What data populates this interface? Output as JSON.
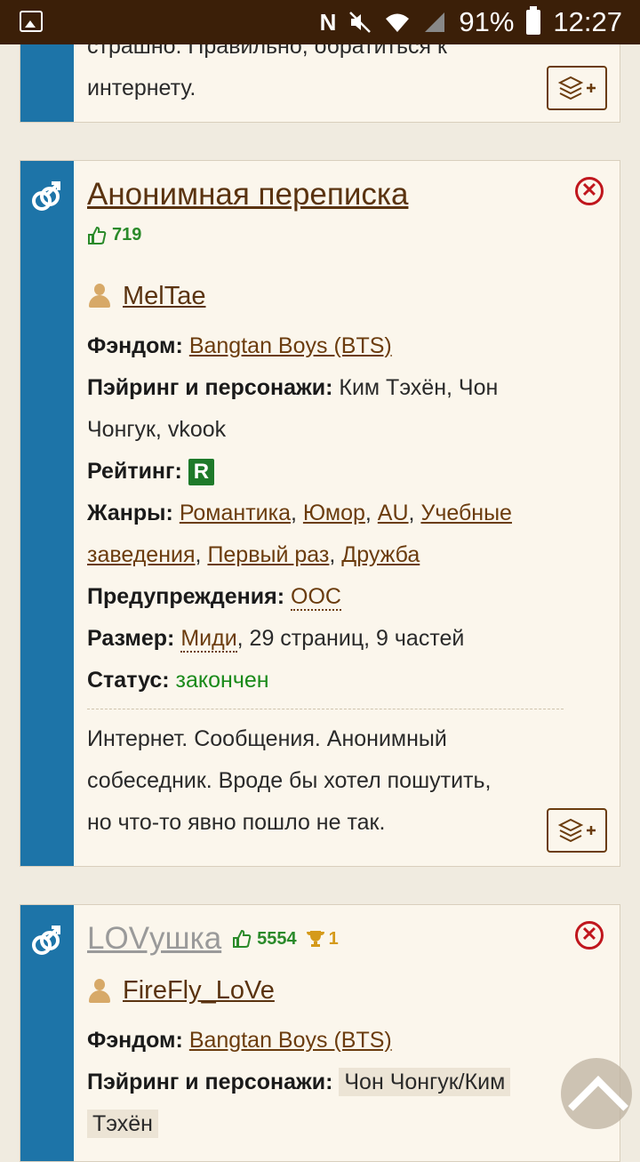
{
  "status_bar": {
    "battery": "91%",
    "time": "12:27",
    "icons": [
      "gallery-icon",
      "nfc-icon",
      "mute-icon",
      "wifi-icon",
      "signal-icon",
      "battery-icon"
    ]
  },
  "card0": {
    "desc_partial": "страшно. Правильно, обратиться к",
    "desc_end": "интернету."
  },
  "card1": {
    "title": "Анонимная переписка",
    "likes": "719",
    "author": "MelTae",
    "fandom_label": "Фэндом:",
    "fandom": "Bangtan Boys (BTS)",
    "pairing_label": "Пэйринг и персонажи:",
    "pairing_line1": "Ким Тэхён, Чон",
    "pairing_line2": "Чонгук, vkook",
    "rating_label": "Рейтинг:",
    "rating": "R",
    "genres_label": "Жанры:",
    "genres": [
      "Романтика",
      "Юмор",
      "AU",
      "Учебные",
      "заведения",
      "Первый раз",
      "Дружба"
    ],
    "warnings_label": "Предупреждения:",
    "warnings": "OOC",
    "size_label": "Размер:",
    "size_link": "Миди",
    "size_rest": ", 29 страниц, 9 частей",
    "status_label": "Статус:",
    "status": "закончен",
    "description_lines": [
      "Интернет. Сообщения. Анонимный",
      "собеседник. Вроде бы хотел пошутить,",
      "но что-то явно пошло не так."
    ]
  },
  "card2": {
    "title": "LOVушка",
    "likes": "5554",
    "trophies": "1",
    "author": "FireFly_LoVe",
    "fandom_label": "Фэндом:",
    "fandom": "Bangtan Boys (BTS)",
    "pairing_label": "Пэйринг и персонажи:",
    "pairing_line1": "Чон Чонгук/Ким",
    "pairing_line2": "Тэхён"
  },
  "colors": {
    "stripe": "#1d74a8",
    "link": "#6b3c0e",
    "likes": "#2a8a2a",
    "rating": "#1e7a2a",
    "close": "#c0161d",
    "status_bar": "#3b1f08"
  }
}
